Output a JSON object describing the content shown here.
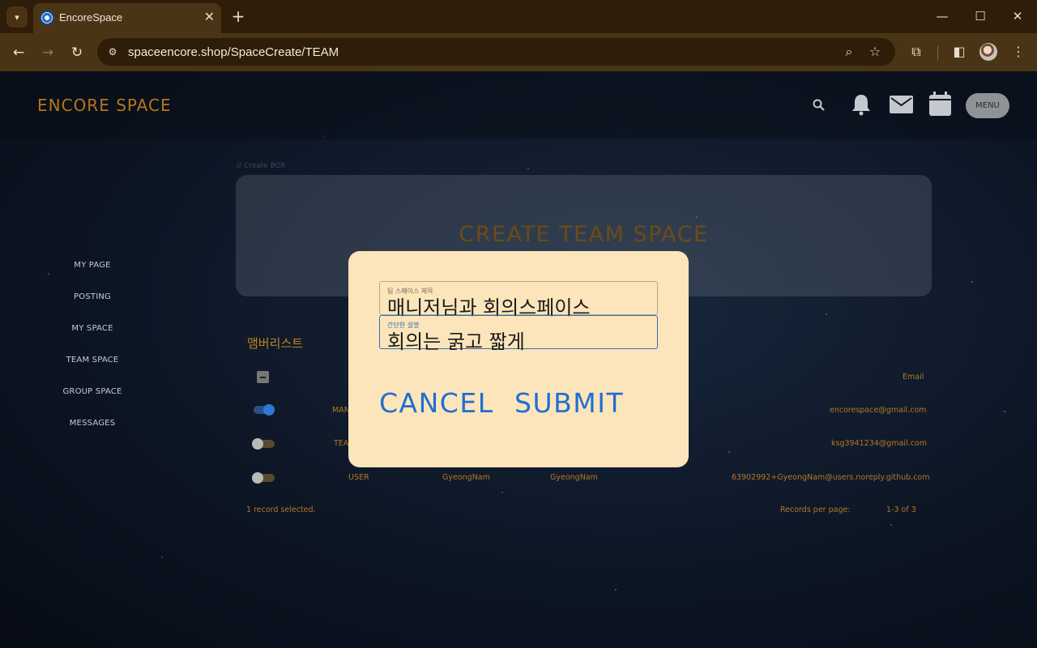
{
  "browser": {
    "tab_title": "EncoreSpace",
    "url": "spaceencore.shop/SpaceCreate/TEAM"
  },
  "header": {
    "brand": "ENCORE SPACE",
    "menu_label": "MENU",
    "icons": [
      "search-icon",
      "bell-icon",
      "mail-icon",
      "calendar-icon"
    ]
  },
  "sidebar": {
    "items": [
      {
        "label": "MY PAGE"
      },
      {
        "label": "POSTING"
      },
      {
        "label": "MY SPACE"
      },
      {
        "label": "TEAM SPACE"
      },
      {
        "label": "GROUP SPACE"
      },
      {
        "label": "MESSAGES"
      }
    ]
  },
  "create_box": {
    "caption": "// Create BOX",
    "title": "CREATE TEAM SPACE"
  },
  "members": {
    "title": "맴버리스트",
    "header_email": "Email",
    "rows": [
      {
        "role": "MAN",
        "name": "",
        "nickname": "",
        "email": "encorespace@gmail.com",
        "selected": true
      },
      {
        "role": "TEA",
        "name": "",
        "nickname": "",
        "email": "ksg3941234@gmail.com",
        "selected": false
      },
      {
        "role": "USER",
        "name": "GyeongNam",
        "nickname": "GyeongNam",
        "email": "63902992+GyeongNam@users.noreply.github.com",
        "selected": false
      }
    ],
    "footer": {
      "selected_text": "1 record selected.",
      "records_per_page": "Records per page:",
      "range": "1-3 of 3"
    }
  },
  "modal": {
    "name_field": {
      "label": "팀 스페이스 제목",
      "value": "매니저님과 회의스페이스"
    },
    "desc_field": {
      "label": "간단한 설명",
      "value": "회의는 굵고 짧게"
    },
    "cancel_label": "CANCEL",
    "submit_label": "SUBMIT"
  }
}
